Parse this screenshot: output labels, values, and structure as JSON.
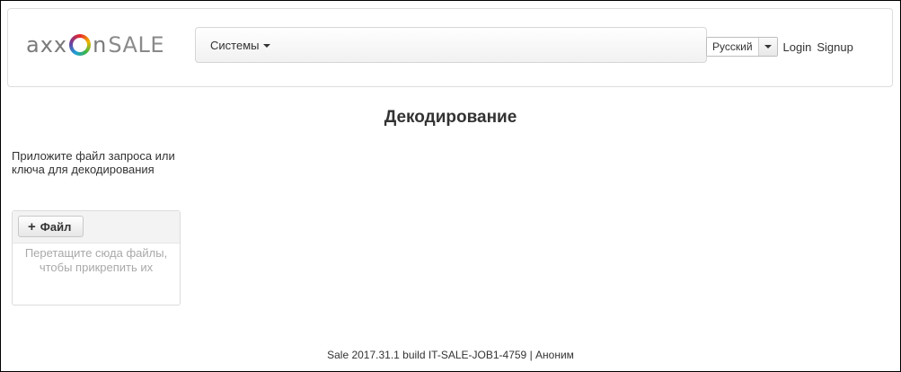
{
  "header": {
    "logo": {
      "part1": "axx",
      "part2": "n",
      "part3": "SALE"
    },
    "menu_label": "Системы",
    "language": {
      "selected": "Русский"
    },
    "login_label": "Login",
    "signup_label": "Signup"
  },
  "main": {
    "title": "Декодирование",
    "attach_instructions": "Приложите файл запроса или ключа для декодирования",
    "file_button_label": "Файл",
    "drop_hint": "Перетащите сюда файлы, чтобы прикрепить их"
  },
  "footer": {
    "text": "Sale 2017.31.1 build IT-SALE-JOB1-4759 | Аноним"
  },
  "icons": {
    "plus": "plus-icon",
    "caret": "caret-down-icon",
    "logo_ring": "logo-ring-icon"
  },
  "colors": {
    "logo_gray": "#7a7a7a",
    "hint_gray": "#a9a9a9",
    "border": "#dddddd"
  }
}
